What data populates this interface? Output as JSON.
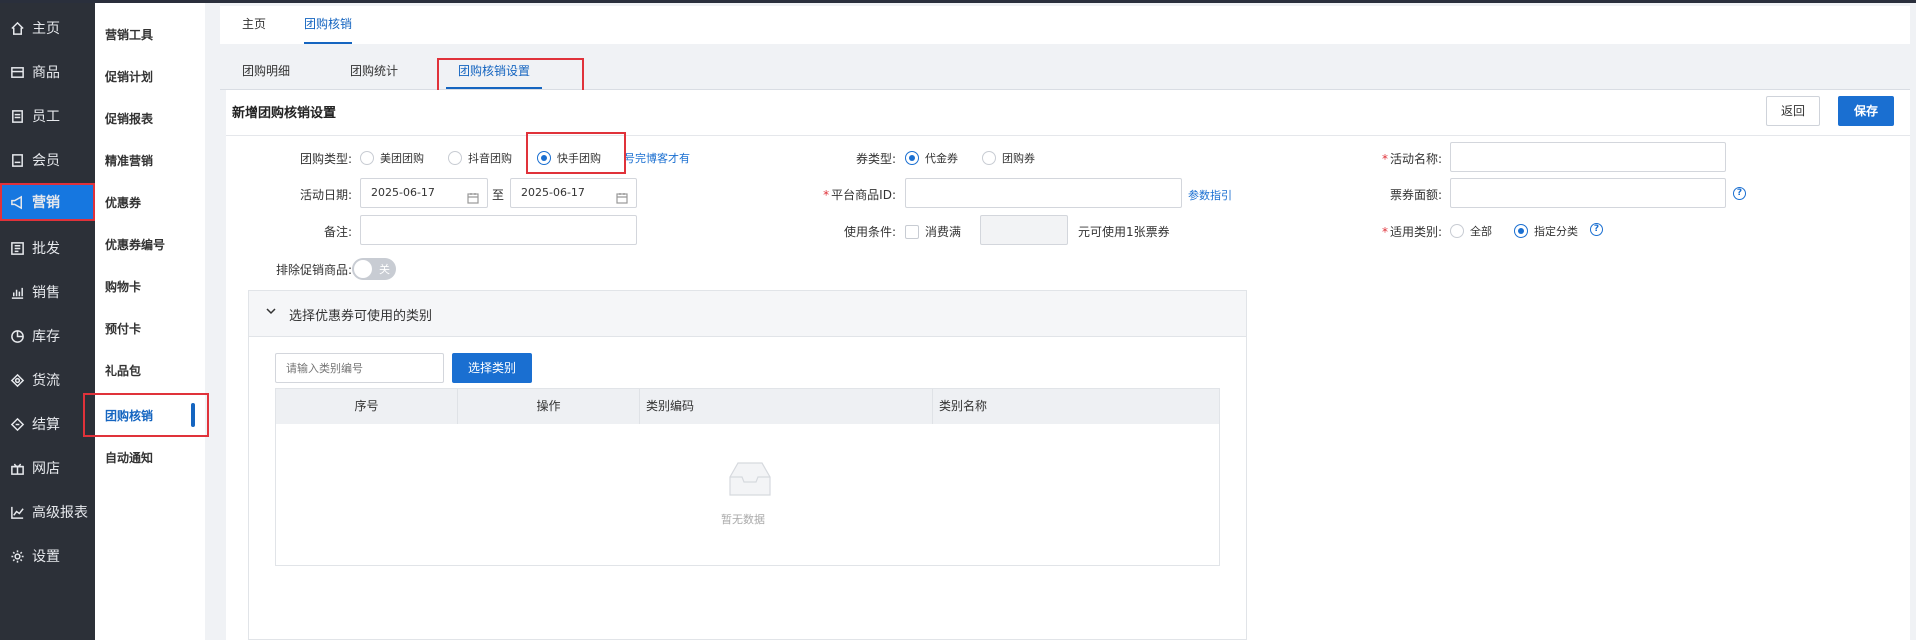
{
  "sidebar": {
    "items": [
      {
        "label": "主页",
        "icon": "home-icon"
      },
      {
        "label": "商品",
        "icon": "goods-icon"
      },
      {
        "label": "员工",
        "icon": "staff-icon"
      },
      {
        "label": "会员",
        "icon": "member-icon"
      },
      {
        "label": "营销",
        "icon": "megaphone-icon"
      },
      {
        "label": "批发",
        "icon": "wholesale-icon"
      },
      {
        "label": "销售",
        "icon": "bar-chart-icon"
      },
      {
        "label": "库存",
        "icon": "pie-chart-icon"
      },
      {
        "label": "货流",
        "icon": "flow-icon"
      },
      {
        "label": "结算",
        "icon": "settle-icon"
      },
      {
        "label": "网店",
        "icon": "shop-icon"
      },
      {
        "label": "高级报表",
        "icon": "line-chart-icon"
      },
      {
        "label": "设置",
        "icon": "gear-icon"
      }
    ]
  },
  "submenu": {
    "items": [
      "营销工具",
      "促销计划",
      "促销报表",
      "精准营销",
      "优惠券",
      "优惠券编号",
      "购物卡",
      "预付卡",
      "礼品包",
      "团购核销",
      "自动通知"
    ]
  },
  "topnav": {
    "tabs": [
      "主页",
      "团购核销"
    ]
  },
  "subtabs": {
    "tabs": [
      "团购明细",
      "团购统计",
      "团购核销设置"
    ]
  },
  "form": {
    "title": "新增团购核销设置",
    "back_label": "返回",
    "save_label": "保存",
    "group_type_label": "团购类型:",
    "group_type_options": [
      "美团团购",
      "抖音团购",
      "快手团购"
    ],
    "group_type_hint": "号完博客才有",
    "date_label": "活动日期:",
    "date_start": "2025-06-17",
    "date_sep": "至",
    "date_end": "2025-06-17",
    "remark_label": "备注:",
    "exclude_label": "排除促销商品:",
    "exclude_toggle": "关",
    "coupon_type_label": "券类型:",
    "coupon_type_options": [
      "代金券",
      "团购券"
    ],
    "platform_id_label": "平台商品ID:",
    "param_link": "参数指引",
    "use_cond_label": "使用条件:",
    "use_cond_check": "消费满",
    "use_cond_suffix": "元可使用1张票券",
    "activity_name_label": "活动名称:",
    "face_value_label": "票券面额:",
    "apply_cat_label": "适用类别:",
    "apply_cat_options": [
      "全部",
      "指定分类"
    ]
  },
  "category_panel": {
    "title": "选择优惠券可使用的类别",
    "input_placeholder": "请输入类别编号",
    "select_button": "选择类别",
    "columns": [
      "序号",
      "操作",
      "类别编码",
      "类别名称"
    ],
    "empty_text": "暂无数据"
  }
}
